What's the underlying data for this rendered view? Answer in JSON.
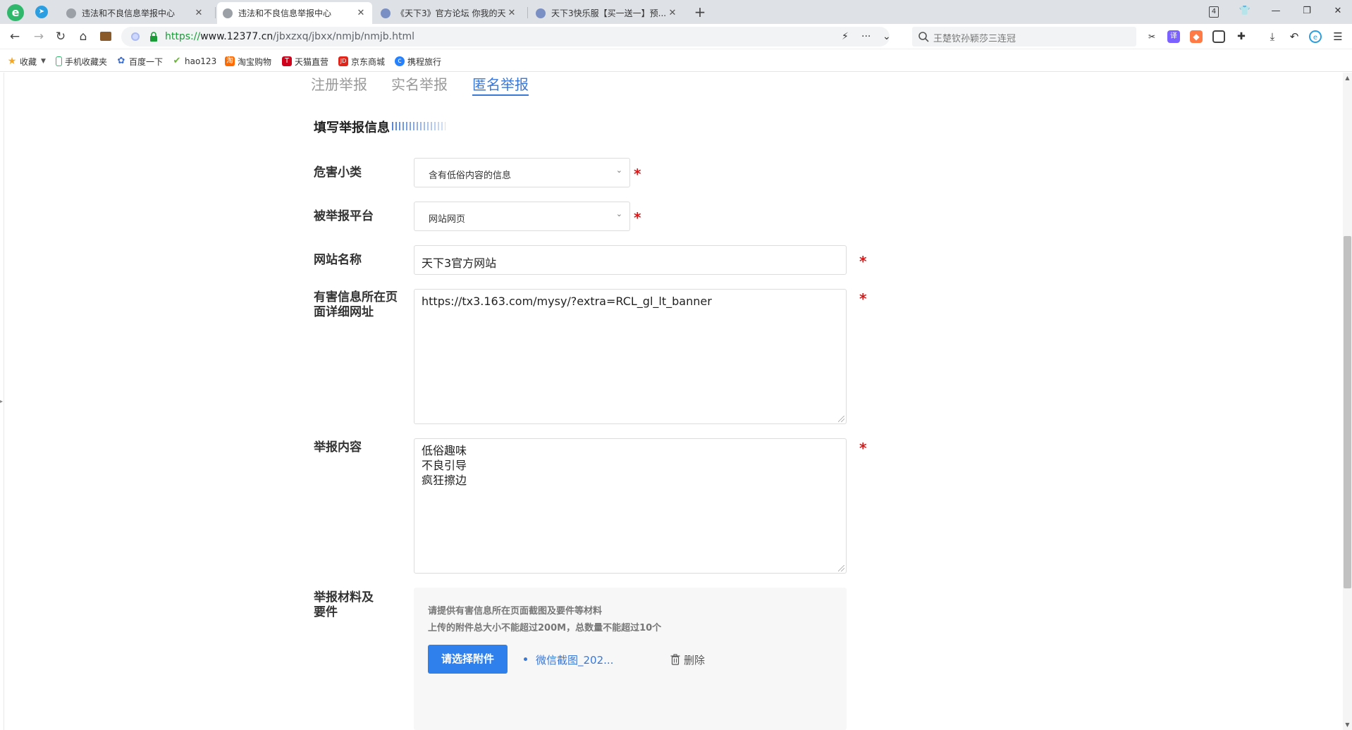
{
  "browser": {
    "tabs": [
      {
        "title": "违法和不良信息举报中心",
        "active": false
      },
      {
        "title": "违法和不良信息举报中心",
        "active": true
      },
      {
        "title": "《天下3》官方论坛 你我的天...",
        "active": false
      },
      {
        "title": "天下3快乐服【买一送一】预...",
        "active": false
      }
    ],
    "tab_count_badge": "4",
    "url": {
      "scheme": "https://",
      "host": "www.12377.cn",
      "path": "/jbxzxq/jbxx/nmjb/nmjb.html"
    },
    "search_text": "王楚钦孙颖莎三连冠",
    "bookmarks": [
      {
        "label": "收藏",
        "icon": "star-icon",
        "color": "#f5a623"
      },
      {
        "label": "手机收藏夹",
        "icon": "phone-icon",
        "color": "#2fb86b"
      },
      {
        "label": "百度一下",
        "icon": "baidu-paw-icon",
        "color": "#3a6fd0"
      },
      {
        "label": "hao123",
        "icon": "hao123-icon",
        "color": "#6cb33e"
      },
      {
        "label": "淘宝购物",
        "icon": "taobao-icon",
        "color": "#ff6a00"
      },
      {
        "label": "天猫直营",
        "icon": "tmall-icon",
        "color": "#d0021b"
      },
      {
        "label": "京东商城",
        "icon": "jd-icon",
        "color": "#e1251b"
      },
      {
        "label": "携程旅行",
        "icon": "ctrip-icon",
        "color": "#2681ff"
      }
    ]
  },
  "page": {
    "report_tabs": [
      {
        "label": "注册举报",
        "active": false
      },
      {
        "label": "实名举报",
        "active": false
      },
      {
        "label": "匿名举报",
        "active": true
      }
    ],
    "section_title": "填写举报信息",
    "fields": {
      "harm_category": {
        "label": "危害小类",
        "value": "含有低俗内容的信息"
      },
      "platform": {
        "label": "被举报平台",
        "value": "网站网页"
      },
      "site_name": {
        "label": "网站名称",
        "value": "天下3官方网站"
      },
      "detail_url": {
        "label_line1": "有害信息所在页",
        "label_line2": "面详细网址",
        "value": "https://tx3.163.com/mysy/?extra=RCL_gl_lt_banner"
      },
      "content": {
        "label": "举报内容",
        "value": "低俗趣味\n不良引导\n疯狂擦边"
      },
      "attachments": {
        "label_line1": "举报材料及",
        "label_line2": "要件",
        "hint1": "请提供有害信息所在页面截图及要件等材料",
        "hint2": "上传的附件总大小不能超过200M，总数量不能超过10个",
        "button": "请选择附件",
        "file_name": "微信截图_202...",
        "delete_label": "删除"
      }
    },
    "required_mark": "*"
  },
  "colors": {
    "accent": "#3a78d6",
    "button": "#2f80ed",
    "required": "#d21a1a"
  }
}
